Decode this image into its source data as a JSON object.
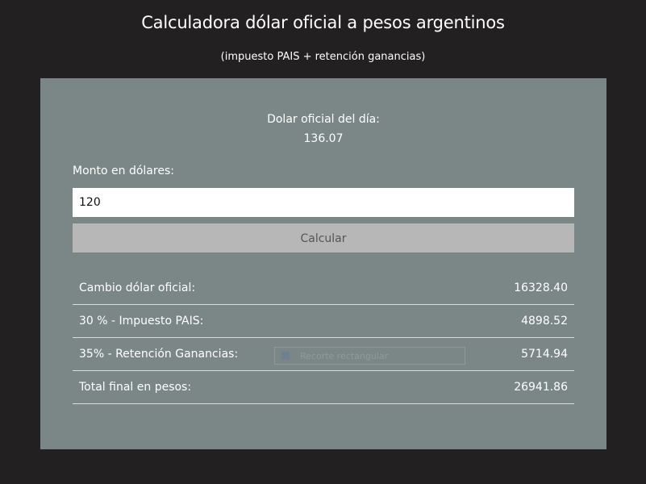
{
  "header": {
    "title": "Calculadora dólar oficial a pesos argentinos",
    "subtitle": "(impuesto PAIS + retención ganancias)"
  },
  "rate": {
    "label": "Dolar oficial del día:",
    "value": "136.07"
  },
  "amount": {
    "label": "Monto en dólares:",
    "value": "120",
    "placeholder": ""
  },
  "calculate_button": {
    "label": "Calcular"
  },
  "results": [
    {
      "label": "Cambio dólar oficial:",
      "value": "16328.40"
    },
    {
      "label": "30 % - Impuesto PAIS:",
      "value": "4898.52"
    },
    {
      "label": "35% - Retención Ganancias:",
      "value": "5714.94"
    },
    {
      "label": "Total final en pesos:",
      "value": "26941.86"
    }
  ],
  "overlay": {
    "text": "Recorte rectangular",
    "icon": "screenshot-icon"
  },
  "colors": {
    "background": "#222021",
    "panel": "#7b8786",
    "button": "#b7b7b7",
    "input": "#ffffff",
    "text": "#ffffff"
  }
}
